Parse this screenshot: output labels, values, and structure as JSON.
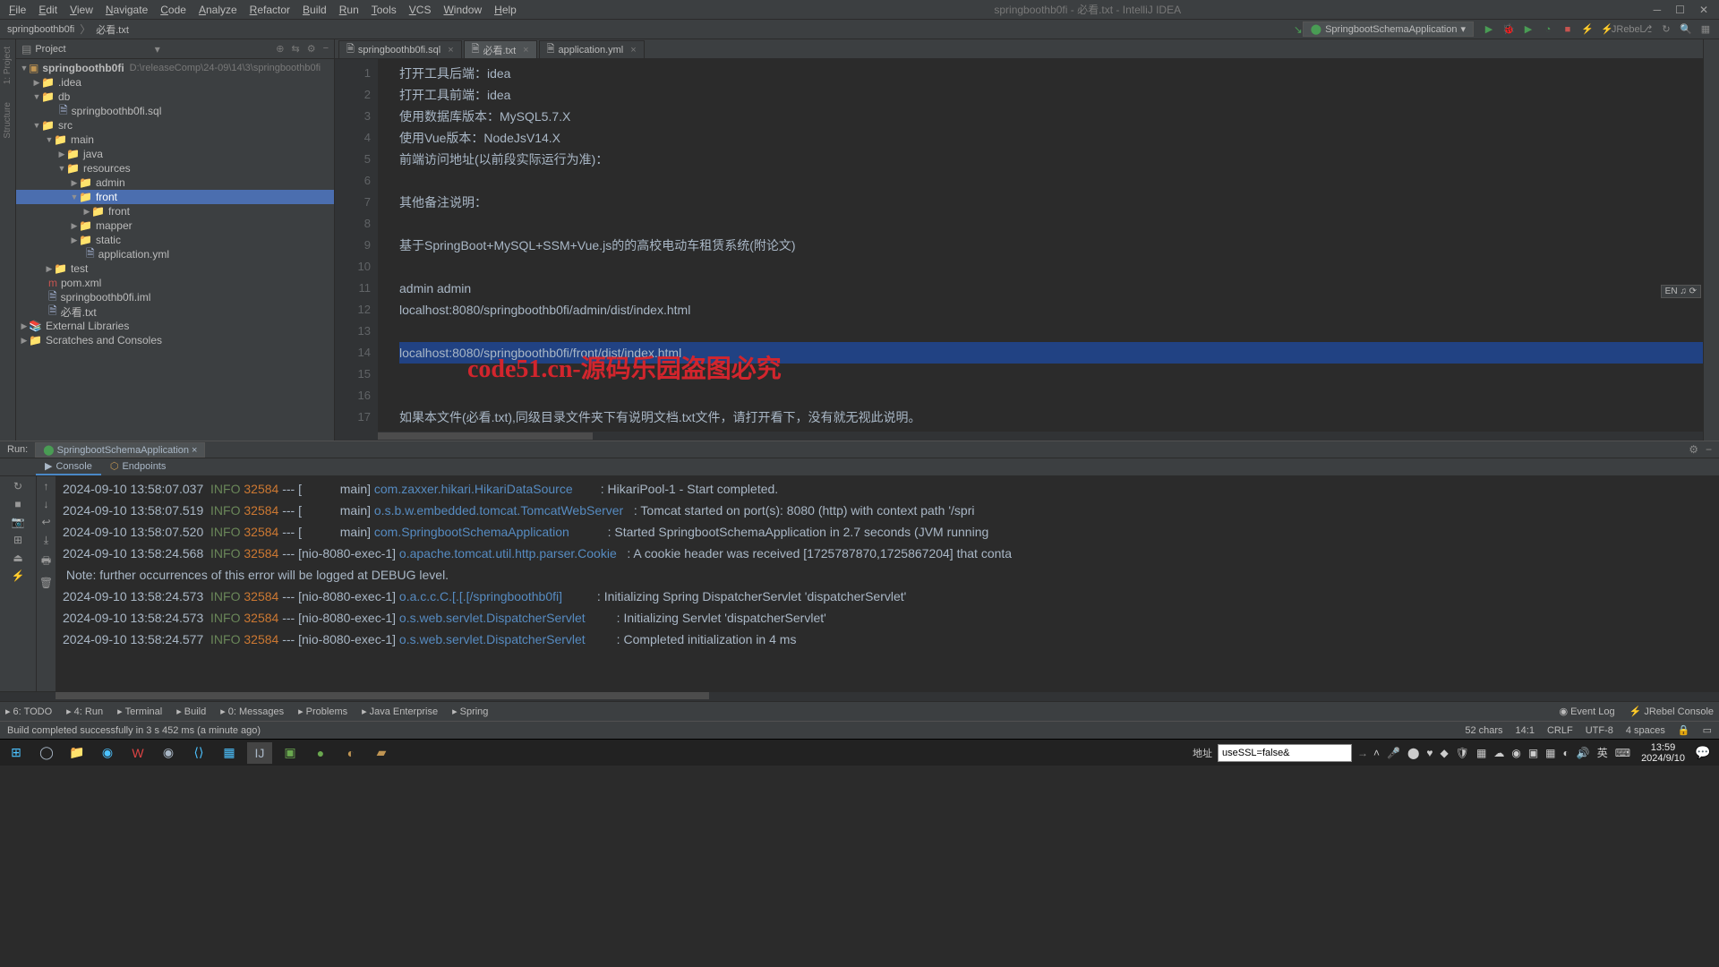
{
  "menu": [
    "File",
    "Edit",
    "View",
    "Navigate",
    "Code",
    "Analyze",
    "Refactor",
    "Build",
    "Run",
    "Tools",
    "VCS",
    "Window",
    "Help"
  ],
  "window_title": "springboothb0fi - 必看.txt - IntelliJ IDEA",
  "breadcrumb": [
    "springboothb0fi",
    "必看.txt"
  ],
  "run_config": "SpringbootSchemaApplication",
  "project_panel_title": "Project",
  "tree": {
    "root": "springboothb0fi",
    "root_path": "D:\\releaseComp\\24-09\\14\\3\\springboothb0fi",
    "idea": ".idea",
    "db": "db",
    "sql": "springboothb0fi.sql",
    "src": "src",
    "main": "main",
    "java": "java",
    "resources": "resources",
    "admin": "admin",
    "front": "front",
    "front2": "front",
    "mapper": "mapper",
    "static": "static",
    "appyml": "application.yml",
    "test": "test",
    "pom": "pom.xml",
    "iml": "springboothb0fi.iml",
    "txt": "必看.txt",
    "ext_lib": "External Libraries",
    "scratch": "Scratches and Consoles"
  },
  "tabs": [
    {
      "label": "springboothb0fi.sql",
      "active": false
    },
    {
      "label": "必看.txt",
      "active": true
    },
    {
      "label": "application.yml",
      "active": false
    }
  ],
  "code_lines": [
    "打开工具后端：idea",
    "打开工具前端：idea",
    "使用数据库版本：MySQL5.7.X",
    "使用Vue版本：NodeJsV14.X",
    "前端访问地址(以前段实际运行为准)：",
    "",
    "其他备注说明：",
    "",
    "基于SpringBoot+MySQL+SSM+Vue.js的的高校电动车租赁系统(附论文)",
    "",
    "admin admin",
    "localhost:8080/springboothb0fi/admin/dist/index.html",
    "",
    "localhost:8080/springboothb0fi/front/dist/index.html",
    "",
    "",
    "如果本文件(必看.txt),同级目录文件夹下有说明文档.txt文件，请打开看下，没有就无视此说明。"
  ],
  "watermark": "code51.cn-源码乐园盗图必究",
  "ime": "EN ♫ ⟳",
  "run_panel": {
    "label": "Run:",
    "config": "SpringbootSchemaApplication",
    "subtabs": [
      "Console",
      "Endpoints"
    ]
  },
  "console_lines": [
    {
      "ts": "2024-09-10 13:58:07.037",
      "lvl": "INFO",
      "pid": "32584",
      "thread": "[           main]",
      "cls": "com.zaxxer.hikari.HikariDataSource",
      "msg": ": HikariPool-1 - Start completed."
    },
    {
      "ts": "2024-09-10 13:58:07.519",
      "lvl": "INFO",
      "pid": "32584",
      "thread": "[           main]",
      "cls": "o.s.b.w.embedded.tomcat.TomcatWebServer",
      "msg": ": Tomcat started on port(s): 8080 (http) with context path '/spri"
    },
    {
      "ts": "2024-09-10 13:58:07.520",
      "lvl": "INFO",
      "pid": "32584",
      "thread": "[           main]",
      "cls": "com.SpringbootSchemaApplication",
      "msg": ": Started SpringbootSchemaApplication in 2.7 seconds (JVM running"
    },
    {
      "ts": "2024-09-10 13:58:24.568",
      "lvl": "INFO",
      "pid": "32584",
      "thread": "[nio-8080-exec-1]",
      "cls": "o.apache.tomcat.util.http.parser.Cookie",
      "msg": ": A cookie header was received [1725787870,1725867204] that conta"
    },
    {
      "note": " Note: further occurrences of this error will be logged at DEBUG level."
    },
    {
      "ts": "2024-09-10 13:58:24.573",
      "lvl": "INFO",
      "pid": "32584",
      "thread": "[nio-8080-exec-1]",
      "cls": "o.a.c.c.C.[.[.[/springboothb0fi]",
      "msg": ": Initializing Spring DispatcherServlet 'dispatcherServlet'"
    },
    {
      "ts": "2024-09-10 13:58:24.573",
      "lvl": "INFO",
      "pid": "32584",
      "thread": "[nio-8080-exec-1]",
      "cls": "o.s.web.servlet.DispatcherServlet",
      "msg": ": Initializing Servlet 'dispatcherServlet'"
    },
    {
      "ts": "2024-09-10 13:58:24.577",
      "lvl": "INFO",
      "pid": "32584",
      "thread": "[nio-8080-exec-1]",
      "cls": "o.s.web.servlet.DispatcherServlet",
      "msg": ": Completed initialization in 4 ms"
    }
  ],
  "bottom_tools": [
    "6: TODO",
    "4: Run",
    "Terminal",
    "Build",
    "0: Messages",
    "Problems",
    "Java Enterprise",
    "Spring"
  ],
  "bottom_right": [
    "Event Log",
    "JRebel Console"
  ],
  "status_msg": "Build completed successfully in 3 s 452 ms (a minute ago)",
  "status_right": {
    "chars": "52 chars",
    "pos": "14:1",
    "crlf": "CRLF",
    "enc": "UTF-8",
    "spaces": "4 spaces"
  },
  "taskbar": {
    "addr_label": "地址",
    "addr_value": "useSSL=false&",
    "clock_time": "13:59",
    "clock_date": "2024/9/10"
  }
}
